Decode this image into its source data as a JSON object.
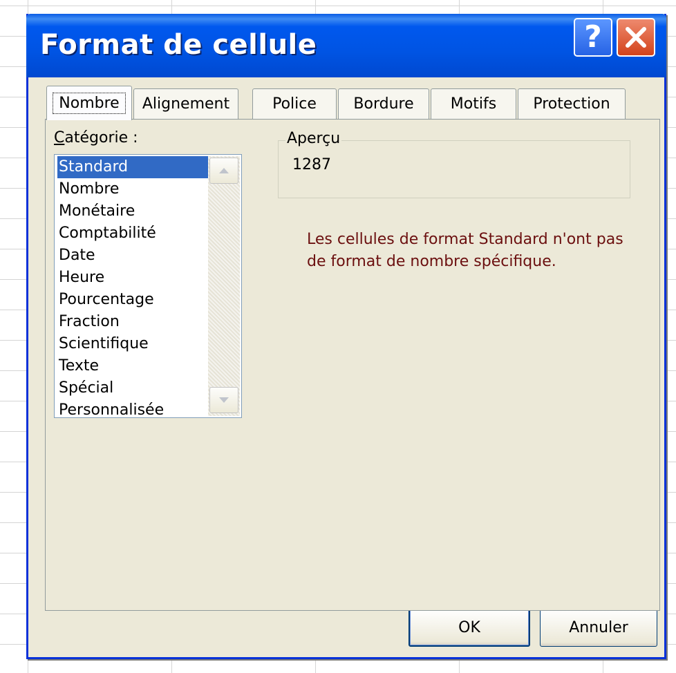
{
  "dialog": {
    "title": "Format de cellule",
    "help_glyph": "?"
  },
  "tabs": [
    {
      "label": "Nombre",
      "active": true
    },
    {
      "label": "Alignement",
      "active": false
    },
    {
      "label": "Police",
      "active": false
    },
    {
      "label": "Bordure",
      "active": false
    },
    {
      "label": "Motifs",
      "active": false
    },
    {
      "label": "Protection",
      "active": false
    }
  ],
  "category": {
    "label_first": "C",
    "label_rest": "atégorie :",
    "items": [
      "Standard",
      "Nombre",
      "Monétaire",
      "Comptabilité",
      "Date",
      "Heure",
      "Pourcentage",
      "Fraction",
      "Scientifique",
      "Texte",
      "Spécial",
      "Personnalisée"
    ],
    "selected": "Standard"
  },
  "preview": {
    "legend": "Aperçu",
    "value": "1287"
  },
  "description": "Les cellules de format Standard n'ont pas de format de nombre spécifique.",
  "buttons": {
    "ok": "OK",
    "cancel": "Annuler"
  },
  "colors": {
    "titlebar": "#0054e3",
    "selection": "#316ac5",
    "description_text": "#6b0f0f",
    "dialog_bg": "#ece9d8"
  }
}
